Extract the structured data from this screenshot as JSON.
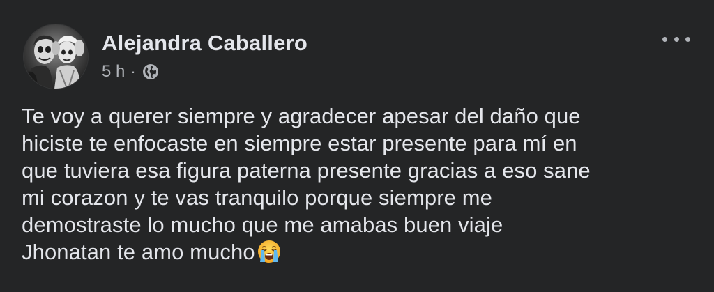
{
  "post": {
    "author": "Alejandra Caballero",
    "time": "5 h",
    "separator": "·",
    "audience_icon": "globe-icon",
    "more_icon": "more-options-icon",
    "message_lines": [
      "Te voy a querer siempre y agradecer apesar del daño que",
      "hiciste te enfocaste en siempre estar presente para mí en",
      "que tuviera esa figura paterna presente gracias a eso sane",
      "mi corazon y te vas tranquilo porque siempre me",
      "demostraste lo mucho que me amabas buen viaje",
      "Jhonatan te amo mucho"
    ],
    "trailing_emoji": "loudly-crying-face-emoji"
  },
  "colors": {
    "background": "#242526",
    "primary_text": "#e4e6eb",
    "secondary_text": "#b0b3b8"
  }
}
